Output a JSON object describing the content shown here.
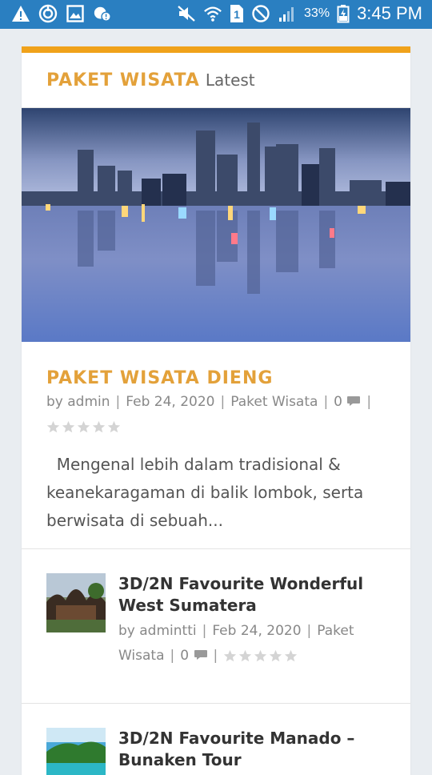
{
  "status_bar": {
    "battery_percent": "33%",
    "time": "3:45 PM",
    "sim": "1"
  },
  "widget": {
    "title": "PAKET WISATA",
    "subtitle": "Latest"
  },
  "featured": {
    "title": "PAKET WISATA DIENG",
    "by_label": "by",
    "author": "admin",
    "date": "Feb 24, 2020",
    "category": "Paket Wisata",
    "comments": "0",
    "rating": 0,
    "excerpt": "Mengenal lebih dalam tradisional & keanekaragaman di balik lombok, serta berwisata di sebuah..."
  },
  "posts": [
    {
      "title": "3D/2N Favourite Wonderful West Sumatera",
      "by_label": "by",
      "author": "admintti",
      "date": "Feb 24, 2020",
      "category": "Paket Wisata",
      "comments": "0",
      "rating": 0
    },
    {
      "title": "3D/2N Favourite Manado – Bunaken Tour"
    }
  ],
  "colors": {
    "accent": "#f0a21b",
    "title": "#e3a13a",
    "status_bar": "#2a7fc1"
  }
}
